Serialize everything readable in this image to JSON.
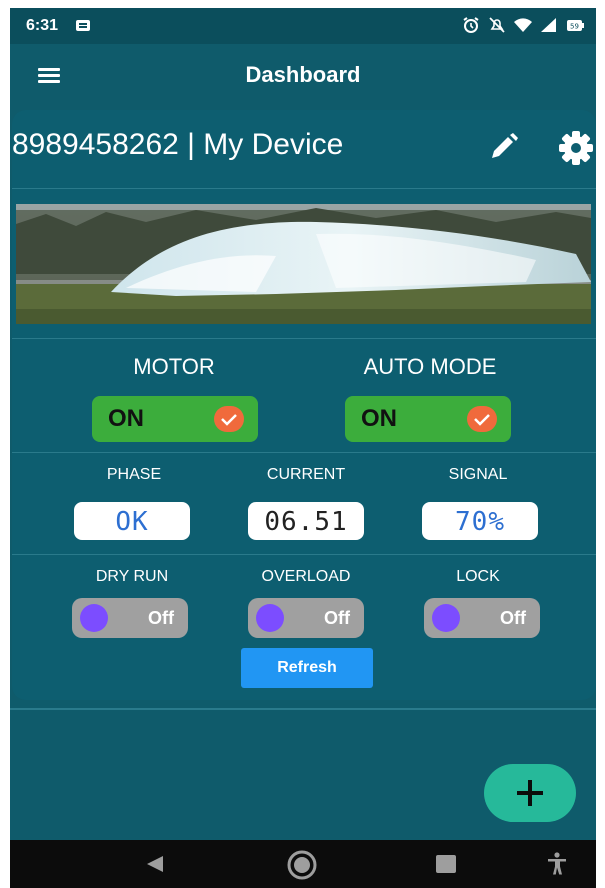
{
  "status_bar": {
    "time": "6:31",
    "icons": [
      "message-icon",
      "alarm-icon",
      "mute-icon",
      "wifi-icon",
      "signal-icon",
      "battery-icon"
    ],
    "battery_level": "59"
  },
  "app_bar": {
    "title": "Dashboard",
    "menu_icon": "hamburger-menu-icon"
  },
  "device": {
    "title": "8989458262 | My Device",
    "edit_icon": "pencil-icon",
    "settings_icon": "gear-icon",
    "image_description": "water-jet-photo"
  },
  "controls": {
    "motor": {
      "label": "MOTOR",
      "state": "ON"
    },
    "auto_mode": {
      "label": "AUTO MODE",
      "state": "ON"
    }
  },
  "stats": {
    "phase": {
      "label": "PHASE",
      "value": "OK"
    },
    "current": {
      "label": "CURRENT",
      "value": "06.51"
    },
    "signal": {
      "label": "SIGNAL",
      "value": "70%"
    }
  },
  "flags": {
    "dry_run": {
      "label": "DRY RUN",
      "state": "Off"
    },
    "overload": {
      "label": "OVERLOAD",
      "state": "Off"
    },
    "lock": {
      "label": "LOCK",
      "state": "Off"
    }
  },
  "refresh_label": "Refresh",
  "fab_icon": "plus-icon",
  "colors": {
    "background": "#0f5b6b",
    "card": "#0d5e70",
    "toggle_on": "#3cad3c",
    "check_badge": "#f06a3c",
    "switch_knob": "#7c4dff",
    "refresh_button": "#2196f3",
    "fab": "#26b99a"
  }
}
